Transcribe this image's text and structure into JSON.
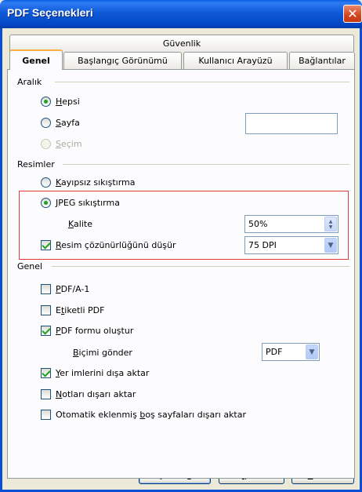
{
  "window": {
    "title": "PDF Seçenekleri",
    "close_glyph": "✕"
  },
  "tabs": {
    "row1": [
      "Güvenlik"
    ],
    "row2": [
      "Genel",
      "Başlangıç Görünümü",
      "Kullanıcı Arayüzü",
      "Bağlantılar"
    ],
    "active": "Genel"
  },
  "range": {
    "header": "Aralık",
    "all": {
      "pre": "",
      "u": "H",
      "post": "epsi",
      "checked": true
    },
    "pages": {
      "pre": "",
      "u": "S",
      "post": "ayfa",
      "checked": false,
      "value": ""
    },
    "selection": {
      "pre": "",
      "u": "S",
      "post": "eçim",
      "checked": false,
      "enabled": false
    }
  },
  "images": {
    "header": "Resimler",
    "lossless": {
      "pre": "",
      "u": "K",
      "post": "ayıpsız sıkıştırma",
      "checked": false
    },
    "jpeg": {
      "pre": "",
      "u": "J",
      "post": "PEG sıkıştırma",
      "checked": true
    },
    "quality": {
      "pre": "",
      "u": "K",
      "post": "alite",
      "value": "50%"
    },
    "reduce": {
      "pre": "",
      "u": "R",
      "post": "esim çözünürlüğünü düşür",
      "checked": true,
      "value": "75 DPI"
    }
  },
  "general": {
    "header": "Genel",
    "pdfa": {
      "pre": "",
      "u": "P",
      "post": "DF/A-1",
      "checked": false
    },
    "tagged": {
      "pre": "E",
      "u": "t",
      "post": "iketli PDF",
      "checked": false
    },
    "form": {
      "pre": "",
      "u": "P",
      "post": "DF formu oluştur",
      "checked": true
    },
    "submit": {
      "pre": "",
      "u": "B",
      "post": "içimi gönder",
      "value": "PDF"
    },
    "bookmarks": {
      "pre": "",
      "u": "Y",
      "post": "er imlerini dışa aktar",
      "checked": true
    },
    "notes": {
      "pre": "",
      "u": "N",
      "post": "otları dışarı aktar",
      "checked": false
    },
    "blank": {
      "pre": "Otomatik eklenmiş ",
      "u": "b",
      "post": "oş sayfaları dışarı aktar",
      "checked": false
    }
  },
  "buttons": {
    "export": {
      "pre": "Dışarı ak",
      "u": "t",
      "post": "ar"
    },
    "cancel": {
      "pre": "",
      "u": "İ",
      "post": "ptal"
    },
    "help": {
      "pre": "",
      "u": "Y",
      "post": "ardım"
    }
  }
}
